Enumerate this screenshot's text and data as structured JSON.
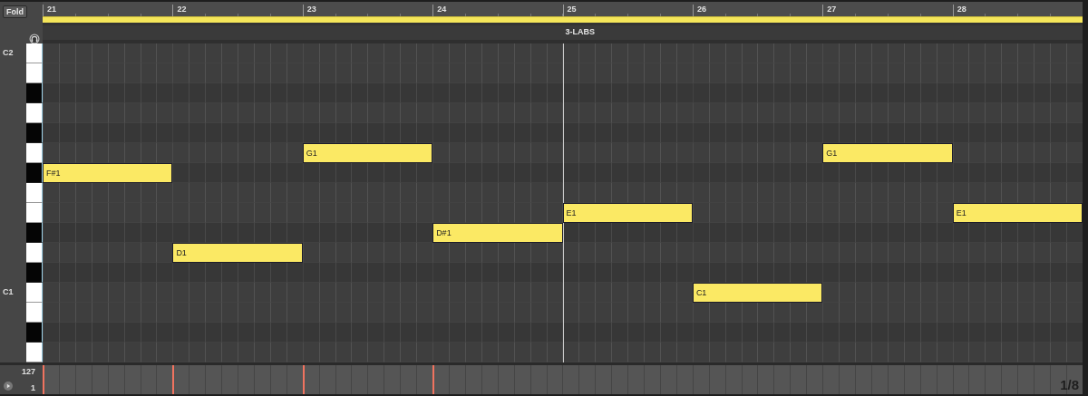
{
  "fold_button": "Fold",
  "ruler": {
    "bars": [
      {
        "label": "21"
      },
      {
        "label": "22"
      },
      {
        "label": "23"
      },
      {
        "label": "24"
      },
      {
        "label": "25",
        "locator": "3-LABS"
      },
      {
        "label": "26"
      },
      {
        "label": "27"
      },
      {
        "label": "28"
      }
    ]
  },
  "rows": [
    {
      "kind": "natural",
      "label": "C2",
      "slots": [
        {
          "kind": "empty"
        },
        {
          "kind": "empty"
        },
        {
          "kind": "empty"
        },
        {
          "kind": "empty"
        },
        {
          "kind": "empty"
        },
        {
          "kind": "empty"
        },
        {
          "kind": "empty"
        },
        {
          "kind": "empty"
        }
      ]
    },
    {
      "kind": "natural",
      "slots": [
        {
          "kind": "empty"
        },
        {
          "kind": "empty"
        },
        {
          "kind": "empty"
        },
        {
          "kind": "empty"
        },
        {
          "kind": "empty"
        },
        {
          "kind": "empty"
        },
        {
          "kind": "empty"
        },
        {
          "kind": "empty"
        }
      ]
    },
    {
      "kind": "sharp",
      "slots": [
        {
          "kind": "empty"
        },
        {
          "kind": "empty"
        },
        {
          "kind": "empty"
        },
        {
          "kind": "empty"
        },
        {
          "kind": "empty"
        },
        {
          "kind": "empty"
        },
        {
          "kind": "empty"
        },
        {
          "kind": "empty"
        }
      ]
    },
    {
      "kind": "natural",
      "slots": [
        {
          "kind": "empty"
        },
        {
          "kind": "empty"
        },
        {
          "kind": "empty"
        },
        {
          "kind": "empty"
        },
        {
          "kind": "empty"
        },
        {
          "kind": "empty"
        },
        {
          "kind": "empty"
        },
        {
          "kind": "empty"
        }
      ]
    },
    {
      "kind": "sharp",
      "slots": [
        {
          "kind": "empty"
        },
        {
          "kind": "empty"
        },
        {
          "kind": "empty"
        },
        {
          "kind": "empty"
        },
        {
          "kind": "empty"
        },
        {
          "kind": "empty"
        },
        {
          "kind": "empty"
        },
        {
          "kind": "empty"
        }
      ]
    },
    {
      "kind": "natural",
      "slots": [
        {
          "kind": "empty"
        },
        {
          "kind": "empty"
        },
        {
          "kind": "note",
          "label": "G1"
        },
        {
          "kind": "empty"
        },
        {
          "kind": "empty"
        },
        {
          "kind": "empty"
        },
        {
          "kind": "note",
          "label": "G1"
        },
        {
          "kind": "empty"
        }
      ]
    },
    {
      "kind": "sharp",
      "slots": [
        {
          "kind": "note",
          "label": "F#1"
        },
        {
          "kind": "empty"
        },
        {
          "kind": "empty"
        },
        {
          "kind": "empty"
        },
        {
          "kind": "empty"
        },
        {
          "kind": "empty"
        },
        {
          "kind": "empty"
        },
        {
          "kind": "empty"
        }
      ]
    },
    {
      "kind": "natural",
      "slots": [
        {
          "kind": "empty"
        },
        {
          "kind": "empty"
        },
        {
          "kind": "empty"
        },
        {
          "kind": "empty"
        },
        {
          "kind": "empty"
        },
        {
          "kind": "empty"
        },
        {
          "kind": "empty"
        },
        {
          "kind": "empty"
        }
      ]
    },
    {
      "kind": "natural",
      "slots": [
        {
          "kind": "empty"
        },
        {
          "kind": "empty"
        },
        {
          "kind": "empty"
        },
        {
          "kind": "empty"
        },
        {
          "kind": "note",
          "label": "E1"
        },
        {
          "kind": "empty"
        },
        {
          "kind": "empty"
        },
        {
          "kind": "note",
          "label": "E1"
        }
      ]
    },
    {
      "kind": "sharp",
      "slots": [
        {
          "kind": "empty"
        },
        {
          "kind": "empty"
        },
        {
          "kind": "empty"
        },
        {
          "kind": "note",
          "label": "D#1"
        },
        {
          "kind": "empty"
        },
        {
          "kind": "empty"
        },
        {
          "kind": "empty"
        },
        {
          "kind": "empty"
        }
      ]
    },
    {
      "kind": "natural",
      "slots": [
        {
          "kind": "empty"
        },
        {
          "kind": "note",
          "label": "D1"
        },
        {
          "kind": "empty"
        },
        {
          "kind": "empty"
        },
        {
          "kind": "empty"
        },
        {
          "kind": "empty"
        },
        {
          "kind": "empty"
        },
        {
          "kind": "empty"
        }
      ]
    },
    {
      "kind": "sharp",
      "slots": [
        {
          "kind": "empty"
        },
        {
          "kind": "empty"
        },
        {
          "kind": "empty"
        },
        {
          "kind": "empty"
        },
        {
          "kind": "empty"
        },
        {
          "kind": "empty"
        },
        {
          "kind": "empty"
        },
        {
          "kind": "empty"
        }
      ]
    },
    {
      "kind": "natural",
      "label": "C1",
      "slots": [
        {
          "kind": "empty"
        },
        {
          "kind": "empty"
        },
        {
          "kind": "empty"
        },
        {
          "kind": "empty"
        },
        {
          "kind": "empty"
        },
        {
          "kind": "note",
          "label": "C1"
        },
        {
          "kind": "empty"
        },
        {
          "kind": "empty"
        }
      ]
    },
    {
      "kind": "natural",
      "slots": [
        {
          "kind": "empty"
        },
        {
          "kind": "empty"
        },
        {
          "kind": "empty"
        },
        {
          "kind": "empty"
        },
        {
          "kind": "empty"
        },
        {
          "kind": "empty"
        },
        {
          "kind": "empty"
        },
        {
          "kind": "empty"
        }
      ]
    },
    {
      "kind": "sharp",
      "slots": [
        {
          "kind": "empty"
        },
        {
          "kind": "empty"
        },
        {
          "kind": "empty"
        },
        {
          "kind": "empty"
        },
        {
          "kind": "empty"
        },
        {
          "kind": "empty"
        },
        {
          "kind": "empty"
        },
        {
          "kind": "empty"
        }
      ]
    },
    {
      "kind": "natural",
      "slots": [
        {
          "kind": "empty"
        },
        {
          "kind": "empty"
        },
        {
          "kind": "empty"
        },
        {
          "kind": "empty"
        },
        {
          "kind": "empty"
        },
        {
          "kind": "empty"
        },
        {
          "kind": "empty"
        },
        {
          "kind": "empty"
        }
      ]
    }
  ],
  "velocity": {
    "max": "127",
    "min": "1",
    "grid": "1/8",
    "markers": [
      {
        "kind": "stem"
      },
      {
        "kind": "stem"
      },
      {
        "kind": "stem"
      },
      {
        "kind": "stem"
      }
    ]
  }
}
